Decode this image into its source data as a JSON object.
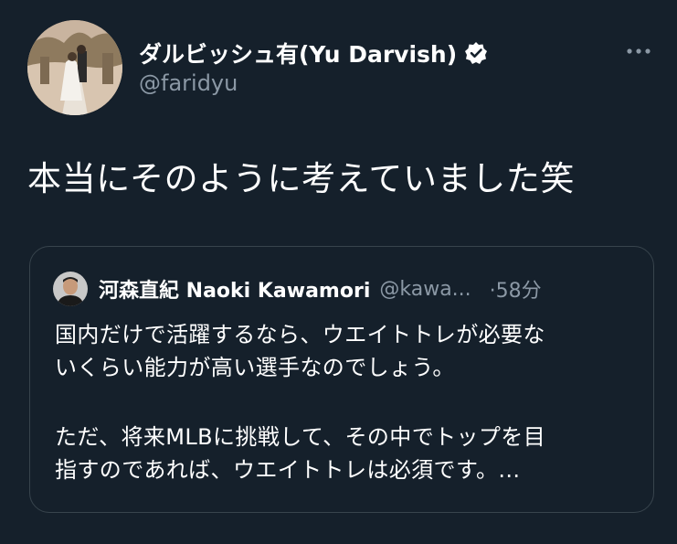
{
  "author": {
    "display_name": "ダルビッシュ有(Yu Darvish)",
    "handle": "@faridyu",
    "verified": true
  },
  "tweet": {
    "text": "本当にそのように考えていました笑"
  },
  "quoted_tweet": {
    "display_name": "河森直紀 Naoki Kawamori",
    "handle": "@kawa...",
    "time": "·58分",
    "lines": [
      "国内だけで活躍するなら、ウエイトトレが必要な",
      "いくらい能力が高い選手なのでしょう。",
      "ただ、将来MLBに挑戦して、その中でトップを目",
      "指すのであれば、ウエイトトレは必須です。..."
    ]
  },
  "icons": {
    "verified": "verified-badge-icon",
    "more": "more-options-icon"
  },
  "colors": {
    "background": "#15202b",
    "secondary_text": "#8b98a5",
    "border": "#38444d",
    "text": "#ffffff"
  }
}
